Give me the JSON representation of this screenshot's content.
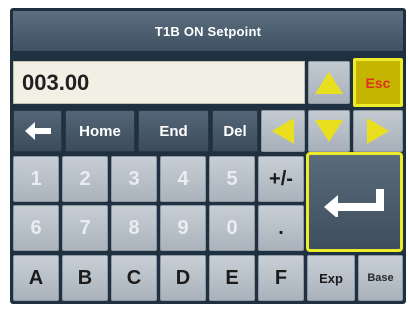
{
  "title": "T1B ON Setpoint",
  "display": {
    "value": "003.00"
  },
  "keys": {
    "backspace_icon": "left-arrow-icon",
    "home": "Home",
    "end": "End",
    "del": "Del",
    "esc": "Esc",
    "plus_minus": "+/-",
    "decimal": ".",
    "exp": "Exp",
    "base": "Base",
    "digits_row1": [
      "1",
      "2",
      "3",
      "4",
      "5"
    ],
    "digits_row2": [
      "6",
      "7",
      "8",
      "9",
      "0"
    ],
    "letters": [
      "A",
      "B",
      "C",
      "D",
      "E",
      "F"
    ],
    "enter_icon": "enter-arrow-icon"
  },
  "colors": {
    "panel": "#1f3140",
    "arrow": "#e9df1f",
    "highlight_border": "#ecec2a",
    "esc_text": "#e0301f"
  }
}
